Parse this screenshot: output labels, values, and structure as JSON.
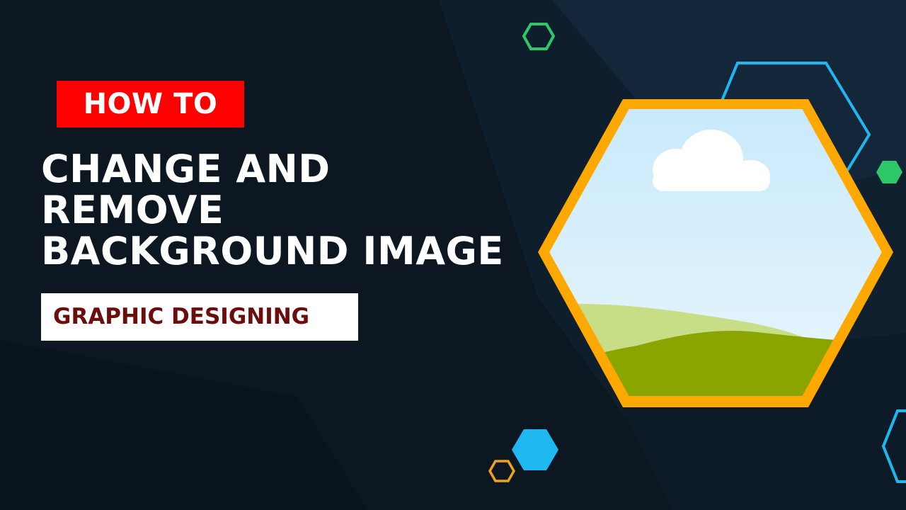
{
  "thumbnail": {
    "kicker": "HOW TO",
    "title_lines": [
      "CHANGE AND",
      "REMOVE",
      "BACKGROUND IMAGE"
    ],
    "category": "GRAPHIC DESIGNING"
  },
  "colors": {
    "background": "#0b1621",
    "kicker_bg": "#ff0000",
    "category_text": "#6b0d0d",
    "hex_frame": "#ffa800",
    "accent_blue": "#1fb7f0",
    "accent_green": "#2ec866",
    "accent_orange": "#f0a21a"
  },
  "icons": {
    "hero": "landscape-image-icon",
    "decor": [
      "hexagon-outline-icon",
      "hexagon-solid-icon"
    ]
  }
}
